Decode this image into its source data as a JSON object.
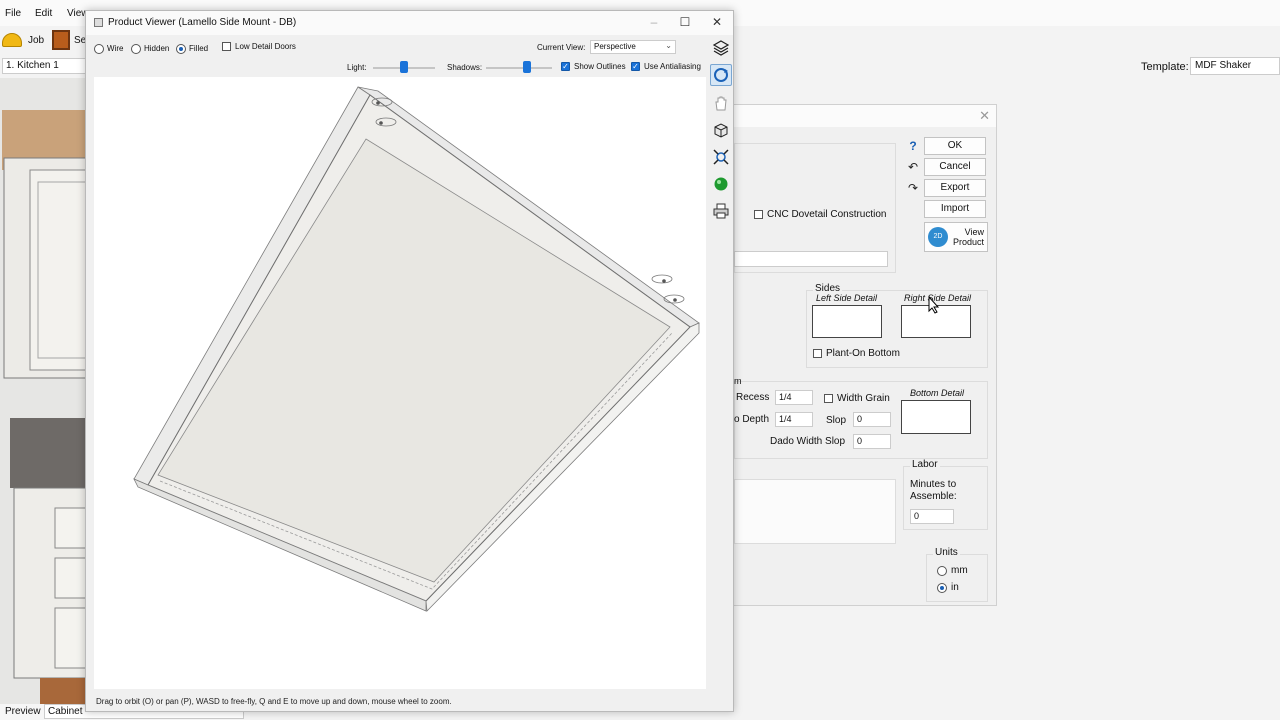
{
  "menu": {
    "file": "File",
    "edit": "Edit",
    "view": "View"
  },
  "toolbar": {
    "job": "Job",
    "se": "Se"
  },
  "room_select": "1. Kitchen 1",
  "template": {
    "label": "Template:",
    "value": "MDF Shaker"
  },
  "bottom": {
    "preview_tab": "Preview",
    "cabinet_select": "Cabinet"
  },
  "viewer": {
    "title": "Product Viewer (Lamello Side Mount - DB)",
    "render_modes": {
      "wire": "Wire",
      "hidden": "Hidden",
      "filled": "Filled",
      "selected": "filled"
    },
    "low_detail_doors": "Low Detail Doors",
    "current_view_label": "Current View:",
    "current_view_value": "Perspective",
    "light_label": "Light:",
    "shadows_label": "Shadows:",
    "light_level": 0.5,
    "shadows_level": 0.62,
    "show_outlines": "Show Outlines",
    "use_antialiasing": "Use Antialiasing",
    "status": "Drag to orbit (O) or pan (P), WASD to free-fly, Q and E to move up and down, mouse wheel to zoom.",
    "tools": [
      "layers-icon",
      "orbit-icon",
      "pan-icon",
      "view-cube-icon",
      "zoom-extents-icon",
      "material-sphere-icon",
      "print-icon"
    ]
  },
  "cabinet_dialog": {
    "buttons": {
      "ok": "OK",
      "cancel": "Cancel",
      "export": "Export",
      "import": "Import",
      "view_product": "View\nProduct"
    },
    "cnc_dovetail": "CNC Dovetail Construction",
    "sides": {
      "title": "Sides",
      "left_detail": "Left Side Detail",
      "right_detail": "Right Side Detail",
      "plant_on_bottom": "Plant-On Bottom"
    },
    "bottom": {
      "title_fragment": "m",
      "recess_label": "Recess",
      "recess_value": "1/4",
      "depth_label": "o Depth",
      "depth_value": "1/4",
      "width_grain": "Width Grain",
      "slop_label": "Slop",
      "slop_value": "0",
      "dado_width_slop_label": "Dado Width Slop",
      "dado_width_slop_value": "0",
      "bottom_detail": "Bottom Detail"
    },
    "labor": {
      "title": "Labor",
      "minutes_label": "Minutes to\nAssemble:",
      "minutes_value": "0"
    },
    "units": {
      "title": "Units",
      "mm": "mm",
      "in": "in",
      "selected": "in"
    }
  }
}
